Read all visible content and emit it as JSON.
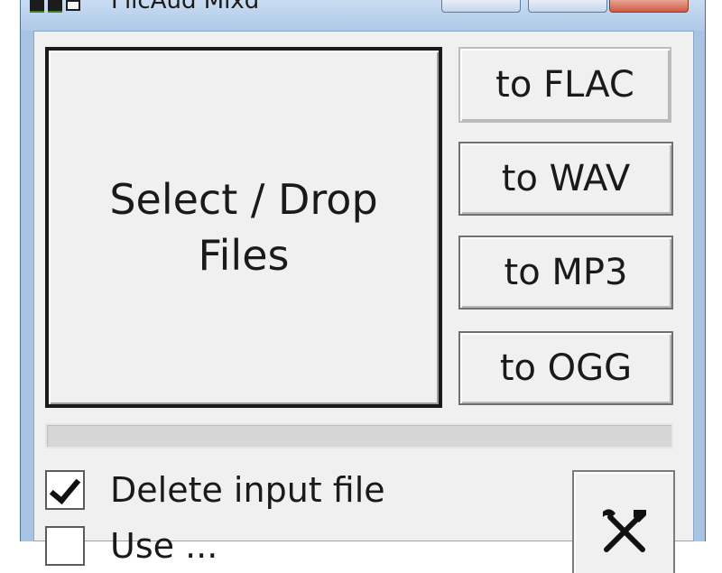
{
  "window": {
    "title": "FlicAud Mixd",
    "icon": "app-icon"
  },
  "main": {
    "drop_button_label": "Select / Drop Files"
  },
  "convert_buttons": [
    {
      "label": "to FLAC"
    },
    {
      "label": "to WAV"
    },
    {
      "label": "to MP3"
    },
    {
      "label": "to OGG"
    }
  ],
  "progress": {
    "value": 0
  },
  "options": {
    "delete_input_label": "Delete input file",
    "delete_input_checked": true,
    "second_label": "Use ...",
    "second_checked": false
  },
  "settings_button": {
    "icon": "tools-icon"
  },
  "colors": {
    "frame": "#a9c3e3",
    "client": "#f0f0f0",
    "close": "#cf5b45"
  }
}
